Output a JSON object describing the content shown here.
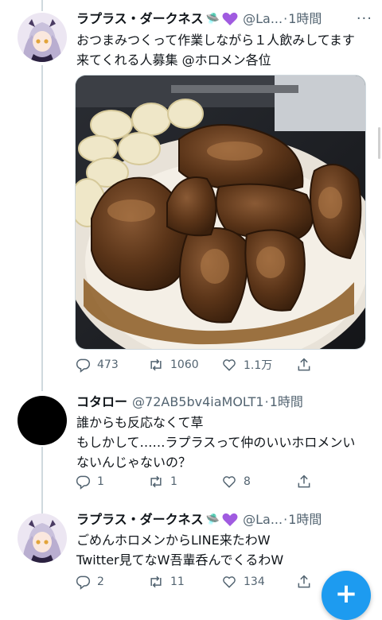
{
  "tweets": [
    {
      "name": "ラプラス・ダークネス",
      "ufo": "🛸",
      "handle": "@La...",
      "dot": "·",
      "time": "1時間",
      "text": "おつまみつくって作業しながら１人飲みしてます 来てくれる人募集 @ホロメン各位",
      "actions": {
        "reply": "473",
        "retweet": "1060",
        "like": "1.1万"
      }
    },
    {
      "name": "コタロー",
      "handle": "@72AB5bv4iaMOLT1",
      "dot": "·",
      "time": "1時間",
      "text": "誰からも反応なくて草\nもしかして……ラプラスって仲のいいホロメンい\nないんじゃないの？",
      "actions": {
        "reply": "1",
        "retweet": "1",
        "like": "8"
      }
    },
    {
      "name": "ラプラス・ダークネス",
      "ufo": "🛸",
      "handle": "@La...",
      "dot": "·",
      "time": "1時間",
      "text": "ごめんホロメンからLINE来たわW\nTwitter見てなW吾輩呑んでくるわW",
      "actions": {
        "reply": "2",
        "retweet": "11",
        "like": "134"
      }
    }
  ],
  "fab": {
    "label": "+"
  },
  "colors": {
    "accent": "#1d9bf0",
    "muted": "#536471",
    "heart": "#a05be0"
  }
}
